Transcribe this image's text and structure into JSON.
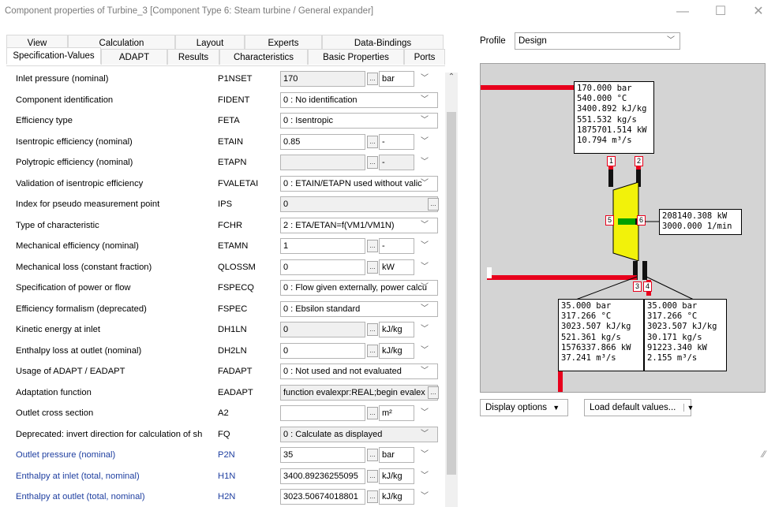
{
  "window": {
    "title": "Component properties of Turbine_3  [Component Type 6: Steam turbine / General expander]",
    "minimize_glyph": "—",
    "maximize_glyph": "☐",
    "close_glyph": "✕"
  },
  "tabs": {
    "row1": [
      "View",
      "Calculation",
      "Layout",
      "Experts",
      "Data-Bindings"
    ],
    "row2": [
      "Specification-Values",
      "ADAPT",
      "Results",
      "Characteristics",
      "Basic Properties",
      "Ports"
    ],
    "active": "Specification-Values"
  },
  "properties": [
    {
      "label": "Inlet pressure (nominal)",
      "code": "P1NSET",
      "value": "170",
      "unit": "bar",
      "field": "narrow",
      "ellipsis": true,
      "gray": true
    },
    {
      "label": "Component identification",
      "code": "FIDENT",
      "value": "0 : No identification",
      "field": "wide"
    },
    {
      "label": "Efficiency type",
      "code": "FETA",
      "value": "0 : Isentropic",
      "field": "wide"
    },
    {
      "label": "Isentropic efficiency (nominal)",
      "code": "ETAIN",
      "value": "0.85",
      "unit": "-",
      "field": "narrow",
      "ellipsis": true
    },
    {
      "label": "Polytropic efficiency (nominal)",
      "code": "ETAPN",
      "value": "",
      "unit": "-",
      "field": "narrow",
      "ellipsis": true,
      "gray": true,
      "unitgray": true
    },
    {
      "label": "Validation of isentropic efficiency",
      "code": "FVALETAI",
      "value": "0 : ETAIN/ETAPN used without valic",
      "field": "wide"
    },
    {
      "label": "Index for pseudo measurement point",
      "code": "IPS",
      "value": "0",
      "field": "wide",
      "gray": true,
      "wideellipsis": true
    },
    {
      "label": "Type of characteristic",
      "code": "FCHR",
      "value": "2 : ETA/ETAN=f(VM1/VM1N)",
      "field": "wide"
    },
    {
      "label": "Mechanical efficiency (nominal)",
      "code": "ETAMN",
      "value": "1",
      "unit": "-",
      "field": "narrow",
      "ellipsis": true
    },
    {
      "label": "Mechanical loss (constant fraction)",
      "code": "QLOSSM",
      "value": "0",
      "unit": "kW",
      "field": "narrow",
      "ellipsis": true
    },
    {
      "label": "Specification of power or flow",
      "code": "FSPECQ",
      "value": "0 : Flow given externally, power calcu",
      "field": "wide"
    },
    {
      "label": "Efficiency formalism (deprecated)",
      "code": "FSPEC",
      "value": "0 : Ebsilon standard",
      "field": "wide"
    },
    {
      "label": "Kinetic energy at inlet",
      "code": "DH1LN",
      "value": "0",
      "unit": "kJ/kg",
      "field": "narrow",
      "ellipsis": true,
      "gray": true
    },
    {
      "label": "Enthalpy loss at outlet (nominal)",
      "code": "DH2LN",
      "value": "0",
      "unit": "kJ/kg",
      "field": "narrow",
      "ellipsis": true
    },
    {
      "label": "Usage of ADAPT / EADAPT",
      "code": "FADAPT",
      "value": "0 : Not used and not evaluated",
      "field": "wide"
    },
    {
      "label": "Adaptation function",
      "code": "EADAPT",
      "value": "function evalexpr:REAL;begin  evalex",
      "field": "wide",
      "gray": true,
      "wideellipsis": true
    },
    {
      "label": "Outlet cross section",
      "code": "A2",
      "value": "",
      "unit": "m²",
      "field": "narrow",
      "ellipsis": true
    },
    {
      "label": "Deprecated: invert direction for calculation of shaf",
      "code": "FQ",
      "value": "0 : Calculate as displayed",
      "field": "wide",
      "gray": true
    },
    {
      "label": "Outlet pressure (nominal)",
      "code": "P2N",
      "value": "35",
      "unit": "bar",
      "field": "narrow",
      "ellipsis": true,
      "blue": true
    },
    {
      "label": "Enthalpy at inlet (total, nominal)",
      "code": "H1N",
      "value": "3400.89236255095",
      "unit": "kJ/kg",
      "field": "narrow",
      "ellipsis": true,
      "blue": true
    },
    {
      "label": "Enthalpy at outlet (total, nominal)",
      "code": "H2N",
      "value": "3023.50674018801",
      "unit": "kJ/kg",
      "field": "narrow",
      "ellipsis": true,
      "blue": true
    }
  ],
  "profile": {
    "label": "Profile",
    "value": "Design"
  },
  "diagram": {
    "inlet_box": "170.000 bar\n540.000 °C\n3400.892 kJ/kg\n551.532 kg/s\n1875701.514 kW\n10.794 m³/s",
    "shaft_box": "208140.308 kW\n3000.000 1/min",
    "outlet3_box": "35.000 bar\n317.266 °C\n3023.507 kJ/kg\n521.361 kg/s\n1576337.866 kW\n37.241 m³/s",
    "outlet4_box": "35.000 bar\n317.266 °C\n3023.507 kJ/kg\n30.171 kg/s\n91223.340 kW\n2.155 m³/s",
    "ports": [
      "1",
      "2",
      "5",
      "6",
      "3",
      "4"
    ]
  },
  "buttons": {
    "display_options": "Display options",
    "load_defaults": "Load default values..."
  },
  "colors": {
    "pipe": "#e8001c",
    "turbine": "#f2f20a",
    "shaft": "#00a000"
  }
}
